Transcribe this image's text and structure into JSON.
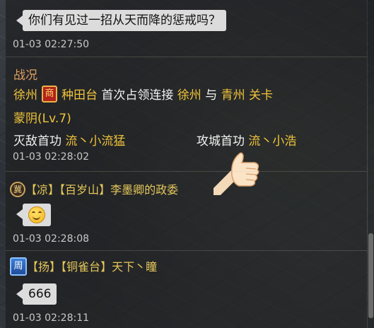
{
  "messages": [
    {
      "text": "你们有见过一招从天而降的惩戒吗？",
      "time": "01-03 02:27:50"
    }
  ],
  "battle": {
    "title": "战况",
    "city1": "徐州",
    "badge": "商",
    "place": "种田台",
    "event": "首次占领连接",
    "city2": "徐州",
    "and": "与",
    "city3": "青州",
    "pass_label": "关卡",
    "pass_name": "蒙阴(Lv.7)",
    "kill_label": "灭敌首功",
    "kill_player": "流丶小流猛",
    "siege_label": "攻城首功",
    "siege_player": "流丶小浩",
    "time": "01-03 02:28:02"
  },
  "chat": [
    {
      "badge": "冀",
      "state": "凉",
      "city": "百岁山",
      "name": "李墨卿的政委",
      "time": "01-03 02:28:08"
    },
    {
      "badge": "周",
      "state": "扬",
      "city": "铜雀台",
      "name": "天下丶瞳",
      "text": "666",
      "time": "01-03 02:28:11"
    }
  ],
  "icons": [
    "smiley-emoji-icon",
    "thumbs-up-icon",
    "faction-badge-icon"
  ],
  "colors": {
    "gold": "#f0c43a",
    "orange_title": "#e0a060",
    "bubble": "#dcdcdc"
  }
}
